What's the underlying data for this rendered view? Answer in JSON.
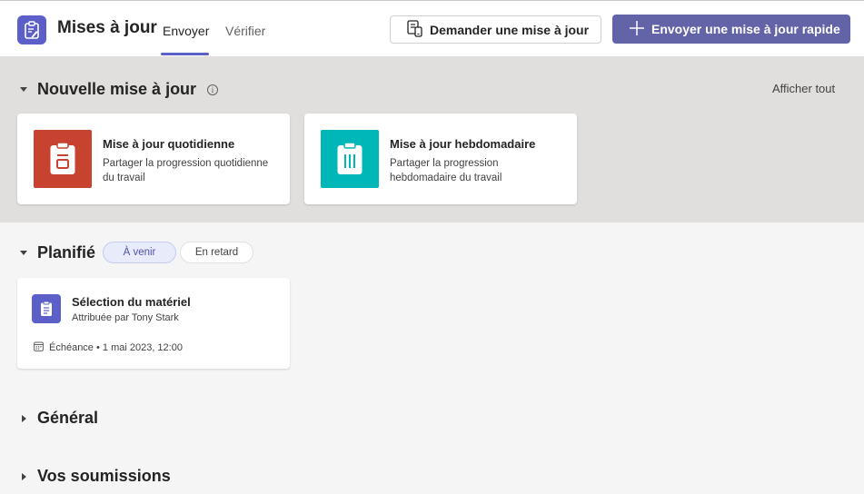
{
  "header": {
    "app_title": "Mises à jour",
    "app_icon": "clipboard-edit-icon",
    "tabs": [
      {
        "label": "Envoyer",
        "active": true
      },
      {
        "label": "Vérifier",
        "active": false
      }
    ],
    "request_button": {
      "label": "Demander une mise à jour",
      "icon": "request-update-icon"
    },
    "quick_button": {
      "label": "Envoyer une mise à jour rapide",
      "icon": "plus-icon"
    }
  },
  "colors": {
    "accent": "#6264a7",
    "brand": "#5b5fc7",
    "daily_tile": "#c7432f",
    "weekly_tile": "#00b7b7"
  },
  "new_section": {
    "title": "Nouvelle mise à jour",
    "info_icon": "info-icon",
    "show_all": "Afficher tout",
    "templates": [
      {
        "name": "Mise à jour quotidienne",
        "description": "Partager la progression quotidienne du travail",
        "icon": "clipboard-day-icon"
      },
      {
        "name": "Mise à jour hebdomadaire",
        "description": "Partager la progression hebdomadaire du travail",
        "icon": "clipboard-week-icon"
      }
    ]
  },
  "scheduled_section": {
    "title": "Planifié",
    "filters": [
      {
        "label": "À venir",
        "selected": true
      },
      {
        "label": "En retard",
        "selected": false
      }
    ],
    "tasks": [
      {
        "title": "Sélection du matériel",
        "assigned_by": "Attribuée par Tony Stark",
        "due": "Échéance • 1 mai 2023, 12:00",
        "icon": "clipboard-icon"
      }
    ]
  },
  "general_section": {
    "title": "Général"
  },
  "submissions_section": {
    "title": "Vos soumissions"
  }
}
